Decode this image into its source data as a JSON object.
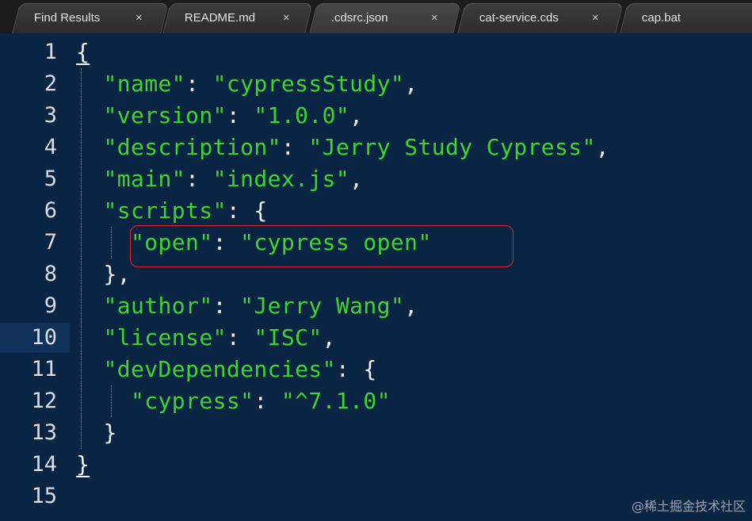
{
  "tabs": [
    {
      "label": "Find Results",
      "close": "×"
    },
    {
      "label": "README.md",
      "close": "×"
    },
    {
      "label": ".cdsrc.json",
      "close": "×"
    },
    {
      "label": "cat-service.cds",
      "close": "×"
    },
    {
      "label": "cap.bat",
      "close": ""
    }
  ],
  "lines": [
    {
      "num": "1",
      "code": "{"
    },
    {
      "num": "2",
      "key": "\"name\"",
      "value": "\"cypressStudy\"",
      "tail": ","
    },
    {
      "num": "3",
      "key": "\"version\"",
      "value": "\"1.0.0\"",
      "tail": ","
    },
    {
      "num": "4",
      "key": "\"description\"",
      "value": "\"Jerry Study Cypress\"",
      "tail": ","
    },
    {
      "num": "5",
      "key": "\"main\"",
      "value": "\"index.js\"",
      "tail": ","
    },
    {
      "num": "6",
      "key": "\"scripts\"",
      "tail": "{"
    },
    {
      "num": "7",
      "key": "\"open\"",
      "value": "\"cypress open\"",
      "tail": ""
    },
    {
      "num": "8",
      "code": "},"
    },
    {
      "num": "9",
      "key": "\"author\"",
      "value": "\"Jerry Wang\"",
      "tail": ","
    },
    {
      "num": "10",
      "key": "\"license\"",
      "value": "\"ISC\"",
      "tail": ","
    },
    {
      "num": "11",
      "key": "\"devDependencies\"",
      "tail": "{"
    },
    {
      "num": "12",
      "key": "\"cypress\"",
      "value": "\"^7.1.0\"",
      "tail": ""
    },
    {
      "num": "13",
      "code": "}"
    },
    {
      "num": "14",
      "code": "}"
    },
    {
      "num": "15",
      "code": ""
    }
  ],
  "current_line": "10",
  "watermark": "@稀土掘金技术社区",
  "colors": {
    "background": "#0a2444",
    "string": "#3cd62d",
    "highlight_box": "#e0262b"
  }
}
